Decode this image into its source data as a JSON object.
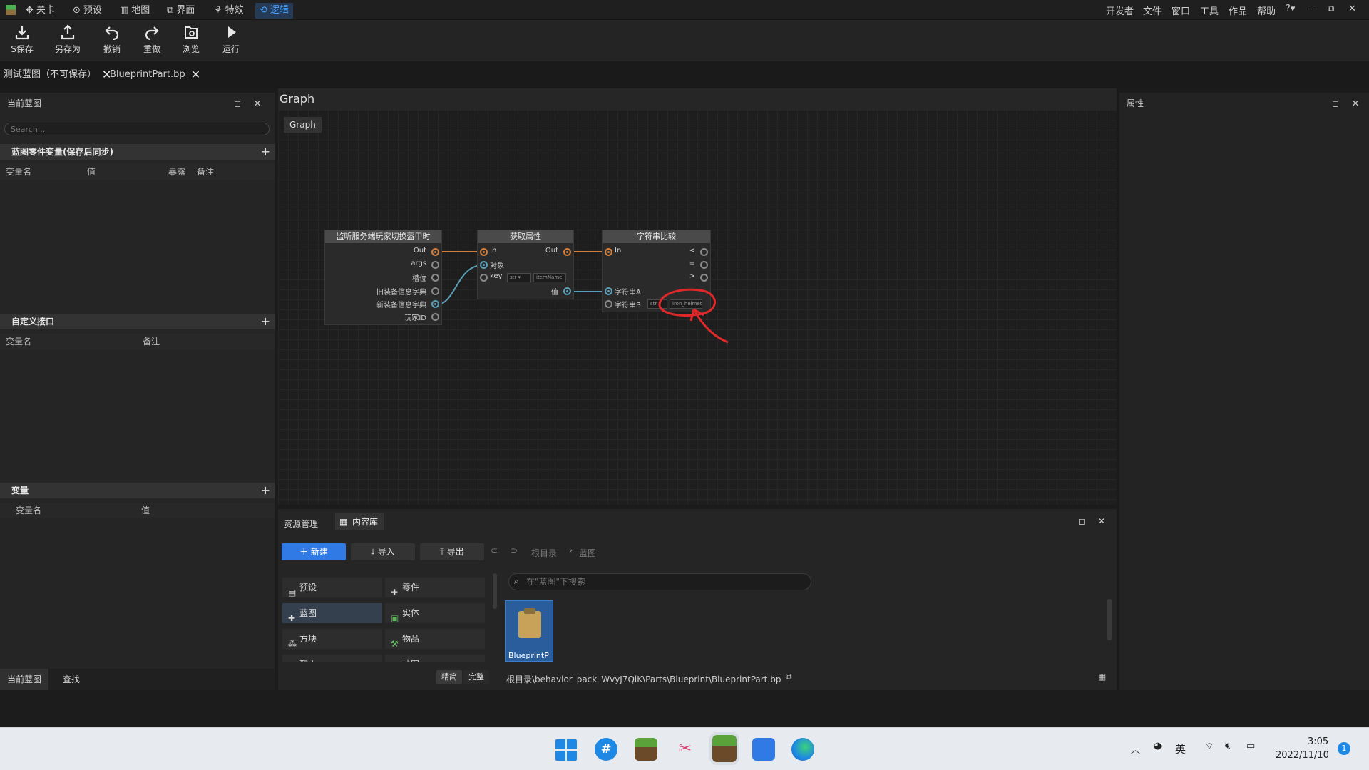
{
  "menubar": {
    "tabs": [
      "关卡",
      "预设",
      "地图",
      "界面",
      "特效",
      "逻辑"
    ],
    "right_menu": [
      "开发者",
      "文件",
      "窗口",
      "工具",
      "作品",
      "帮助"
    ],
    "accent": "#4aa3ff"
  },
  "toolbar": {
    "buttons": [
      "S保存",
      "另存为",
      "撤销",
      "重做",
      "浏览",
      "运行"
    ]
  },
  "doctabs": [
    "测试蓝图（不可保存）",
    "BlueprintPart.bp"
  ],
  "left": {
    "title": "当前蓝图",
    "search_placeholder": "Search...",
    "sections": [
      {
        "title": "蓝图零件变量(保存后同步)",
        "cols": [
          "变量名",
          "值",
          "暴露",
          "备注"
        ]
      },
      {
        "title": "自定义接口",
        "cols": [
          "变量名",
          "备注"
        ]
      },
      {
        "title": "变量",
        "cols": [
          "变量名",
          "值"
        ]
      }
    ],
    "bottom_tabs": [
      "当前蓝图",
      "查找"
    ]
  },
  "graph": {
    "title": "Graph",
    "breadcrumb": "Graph",
    "nodes": [
      {
        "title": "监听服务端玩家切换盔甲时",
        "pins": [
          "Out",
          "args",
          "槽位",
          "旧装备信息字典",
          "新装备信息字典",
          "玩家ID"
        ]
      },
      {
        "title": "获取属性",
        "pins_in": [
          "In",
          "对象",
          "key"
        ],
        "pins_out": [
          "Out",
          "值"
        ],
        "key_type": "str",
        "key_value": "itemName"
      },
      {
        "title": "字符串比较",
        "pins_in": [
          "In",
          "字符串A",
          "字符串B"
        ],
        "pins_out": [
          "<",
          "=",
          ">"
        ],
        "b_type": "str",
        "b_value": "iron_helmet"
      }
    ],
    "annotation_color": "#e0282a"
  },
  "properties": {
    "title": "属性"
  },
  "resources": {
    "tabs": [
      "资源管理",
      "内容库"
    ],
    "buttons": {
      "new": "新建",
      "import": "导入",
      "export": "导出"
    },
    "path_root": "根目录",
    "path_current": "蓝图",
    "search_placeholder": "在\"蓝图\"下搜索",
    "categories": [
      "预设",
      "零件",
      "蓝图",
      "实体",
      "方块",
      "物品",
      "配方",
      "地图"
    ],
    "file_label": "BlueprintP",
    "view_modes": [
      "精简",
      "完整"
    ],
    "full_path": "根目录\\behavior_pack_WvyJ7QiK\\Parts\\Blueprint\\BlueprintPart.bp"
  },
  "taskbar": {
    "lang": "英",
    "time": "3:05",
    "date": "2022/11/10",
    "notifications": "1"
  }
}
